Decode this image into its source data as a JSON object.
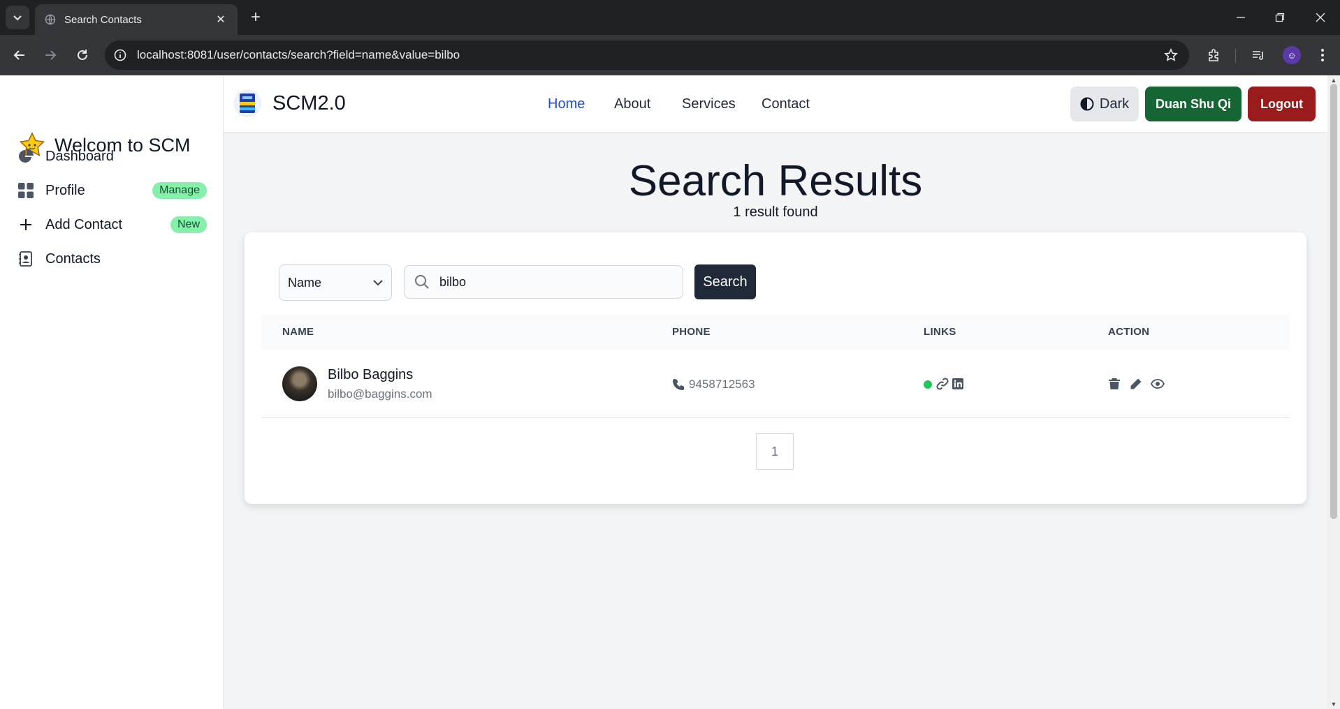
{
  "browser": {
    "tab_title": "Search Contacts",
    "url": "localhost:8081/user/contacts/search?field=name&value=bilbo"
  },
  "sidebar": {
    "brand": "Welcom to SCM",
    "items": [
      {
        "label": "Dashboard",
        "icon": "pie-chart-icon"
      },
      {
        "label": "Profile",
        "icon": "grid-icon",
        "badge": "Manage"
      },
      {
        "label": "Add Contact",
        "icon": "plus-icon",
        "badge": "New"
      },
      {
        "label": "Contacts",
        "icon": "address-book-icon"
      }
    ]
  },
  "header": {
    "brand": "SCM2.0",
    "nav": [
      "Home",
      "About",
      "Services",
      "Contact"
    ],
    "active_nav": "Home",
    "theme_button": "Dark",
    "user_button": "Duan Shu Qi",
    "logout_button": "Logout"
  },
  "main": {
    "title": "Search Results",
    "subtitle": "1 result found",
    "search": {
      "field_value": "Name",
      "query_value": "bilbo",
      "button_label": "Search"
    },
    "table": {
      "columns": [
        "NAME",
        "PHONE",
        "LINKS",
        "ACTION"
      ],
      "rows": [
        {
          "name": "Bilbo Baggins",
          "email": "bilbo@baggins.com",
          "phone": "9458712563",
          "favorite": true
        }
      ]
    },
    "pagination": {
      "current": "1"
    }
  },
  "colors": {
    "accent": "#1d4ed8",
    "user_button": "#166534",
    "logout_button": "#991b1b",
    "badge": "#86efac",
    "search_button": "#1f2937",
    "status_dot": "#22c55e"
  }
}
